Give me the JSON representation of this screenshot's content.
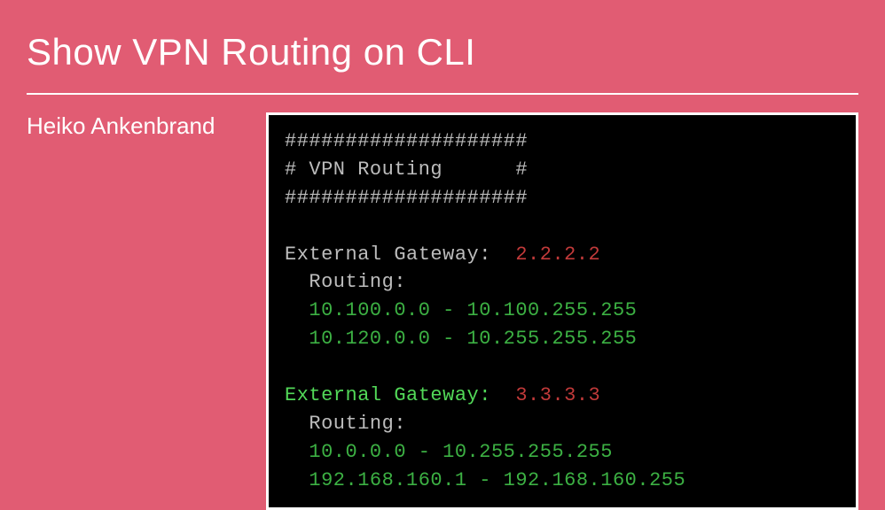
{
  "title": "Show VPN Routing on CLI",
  "author": "Heiko Ankenbrand",
  "terminal": {
    "banner_top": "####################",
    "banner_mid": "# VPN Routing      #",
    "banner_bot": "####################",
    "blocks": [
      {
        "gateway_label": "External Gateway:",
        "gateway_value": "2.2.2.2",
        "routing_label": "Routing:",
        "routes": [
          "10.100.0.0 - 10.100.255.255",
          "10.120.0.0 - 10.255.255.255"
        ]
      },
      {
        "gateway_label": "External Gateway:",
        "gateway_value": "3.3.3.3",
        "routing_label": "Routing:",
        "routes": [
          "10.0.0.0 - 10.255.255.255",
          "192.168.160.1 - 192.168.160.255"
        ]
      }
    ]
  }
}
